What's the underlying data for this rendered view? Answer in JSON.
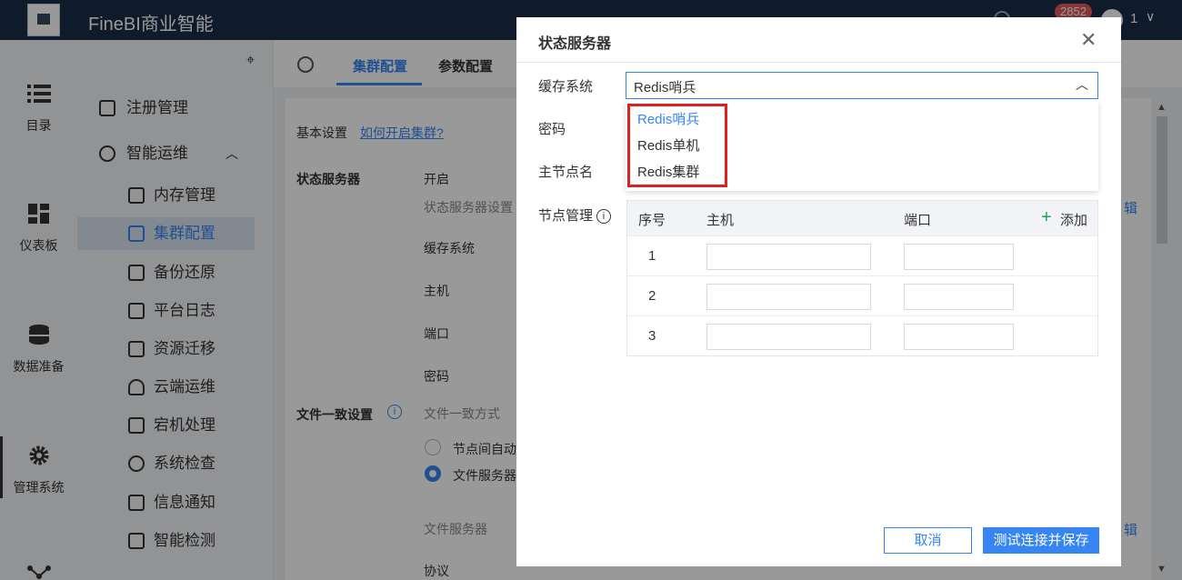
{
  "header": {
    "app_title": "FineBI商业智能",
    "badge": "2852",
    "user": "1"
  },
  "rail": [
    {
      "label": "目录"
    },
    {
      "label": "仪表板"
    },
    {
      "label": "数据准备"
    },
    {
      "label": "管理系统"
    }
  ],
  "menu": {
    "items": [
      {
        "label": "注册管理"
      },
      {
        "label": "智能运维"
      },
      {
        "label": "内存管理"
      },
      {
        "label": "集群配置"
      },
      {
        "label": "备份还原"
      },
      {
        "label": "平台日志"
      },
      {
        "label": "资源迁移"
      },
      {
        "label": "云端运维"
      },
      {
        "label": "宕机处理"
      },
      {
        "label": "系统检查"
      },
      {
        "label": "信息通知"
      },
      {
        "label": "智能检测"
      }
    ]
  },
  "content": {
    "tabs": [
      "集群配置",
      "参数配置"
    ],
    "basic_settings": "基本设置",
    "how_link": "如何开启集群?",
    "state_server": "状态服务器",
    "open": "开启",
    "state_server_setting": "状态服务器设置",
    "cache_system": "缓存系统",
    "host": "主机",
    "port": "端口",
    "password": "密码",
    "file_consistency": "文件一致设置",
    "file_consistency_mode": "文件一致方式",
    "radio_node": "节点间自动",
    "radio_file_server": "文件服务器",
    "file_server": "文件服务器",
    "protocol": "协议",
    "edit_1": "辑",
    "edit_2": "辑"
  },
  "dialog": {
    "title": "状态服务器",
    "fields": {
      "cache_system": "缓存系统",
      "password": "密码",
      "master_name": "主节点名",
      "node_mgmt": "节点管理"
    },
    "select_value": "Redis哨兵",
    "options": [
      "Redis哨兵",
      "Redis单机",
      "Redis集群"
    ],
    "table": {
      "headers": [
        "序号",
        "主机",
        "端口"
      ],
      "add": "添加",
      "rows": [
        "1",
        "2",
        "3"
      ]
    },
    "buttons": {
      "cancel": "取消",
      "save": "测试连接并保存"
    }
  }
}
